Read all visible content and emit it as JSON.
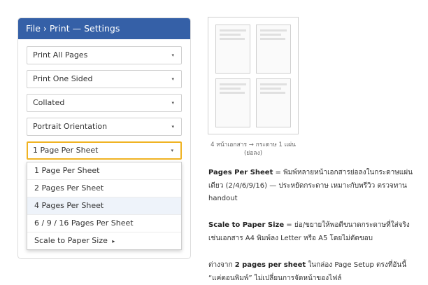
{
  "panel": {
    "title": "File › Print — Settings",
    "selects": [
      {
        "label": "Print All Pages"
      },
      {
        "label": "Print One Sided"
      },
      {
        "label": "Collated"
      },
      {
        "label": "Portrait Orientation"
      },
      {
        "label": "1 Page Per Sheet"
      }
    ],
    "caret": "▾",
    "active_select": 4,
    "accent_color": "#3560a7",
    "highlight_color": "#f0b323",
    "dropdown": {
      "options": [
        {
          "label": "1 Page Per Sheet"
        },
        {
          "label": "2 Pages Per Sheet"
        },
        {
          "label": "4 Pages Per Sheet"
        },
        {
          "label": "6 / 9 / 16 Pages Per Sheet"
        },
        {
          "label": "Scale to Paper Size",
          "suffix": "▸"
        }
      ],
      "hovered_option": 2
    }
  },
  "preview": {
    "caption": "4 หน้าเอกสาร → กระดาษ 1 แผ่น (ย่อลง)"
  },
  "notes": [
    {
      "term": "Pages Per Sheet",
      "text": " = พิมพ์หลายหน้าเอกสารย่อลงในกระดาษแผ่นเดียว (2/4/6/9/16) — ประหยัดกระดาษ เหมาะกับพรีวิว ตรวจทาน handout"
    },
    {
      "term": "Scale to Paper Size",
      "text": " = ย่อ/ขยายให้พอดีขนาดกระดาษที่ใส่จริง เช่นเอกสาร A4 พิมพ์ลง Letter หรือ A5 โดยไม่ตัดขอบ"
    },
    {
      "prefix": "ต่างจาก ",
      "term": "2 pages per sheet",
      "text": " ในกล่อง Page Setup ตรงที่อันนี้ “แค่ตอนพิมพ์” ไม่เปลี่ยนการจัดหน้าของไฟล์"
    }
  ]
}
